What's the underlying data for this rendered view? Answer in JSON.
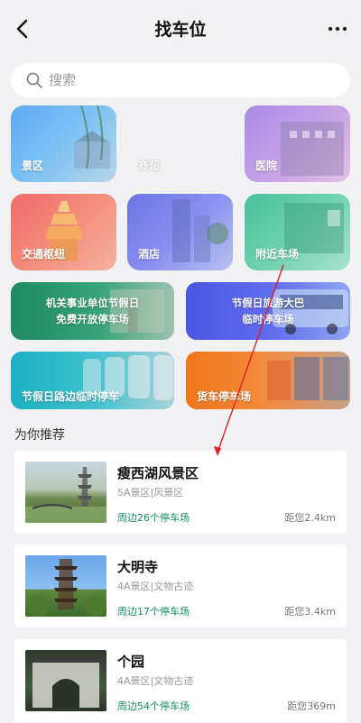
{
  "header": {
    "title": "找车位"
  },
  "search": {
    "placeholder": "搜索"
  },
  "categories": [
    {
      "label": "景区"
    },
    {
      "label": "商超"
    },
    {
      "label": "医院"
    },
    {
      "label": "交通枢纽"
    },
    {
      "label": "酒店"
    },
    {
      "label": "附近车场"
    }
  ],
  "promos": [
    {
      "line1": "机关事业单位节假日",
      "line2": "免费开放停车场"
    },
    {
      "line1": "节假日旅游大巴",
      "line2": "临时停车场"
    },
    {
      "label": "节假日路边临时停车"
    },
    {
      "label": "货车停车场"
    }
  ],
  "recommend": {
    "title": "为你推荐",
    "items": [
      {
        "name": "瘦西湖风景区",
        "tags": "5A景区|风景区",
        "lots": "周边26个停车场",
        "distance": "距您2.4km"
      },
      {
        "name": "大明寺",
        "tags": "4A景区|文物古迹",
        "lots": "周边17个停车场",
        "distance": "距您3.4km"
      },
      {
        "name": "个园",
        "tags": "4A景区|文物古迹",
        "lots": "周边54个停车场",
        "distance": "距您369m"
      }
    ]
  },
  "colors": {
    "accent_green": "#0f8f6a",
    "annotation_arrow": "#e02020"
  }
}
